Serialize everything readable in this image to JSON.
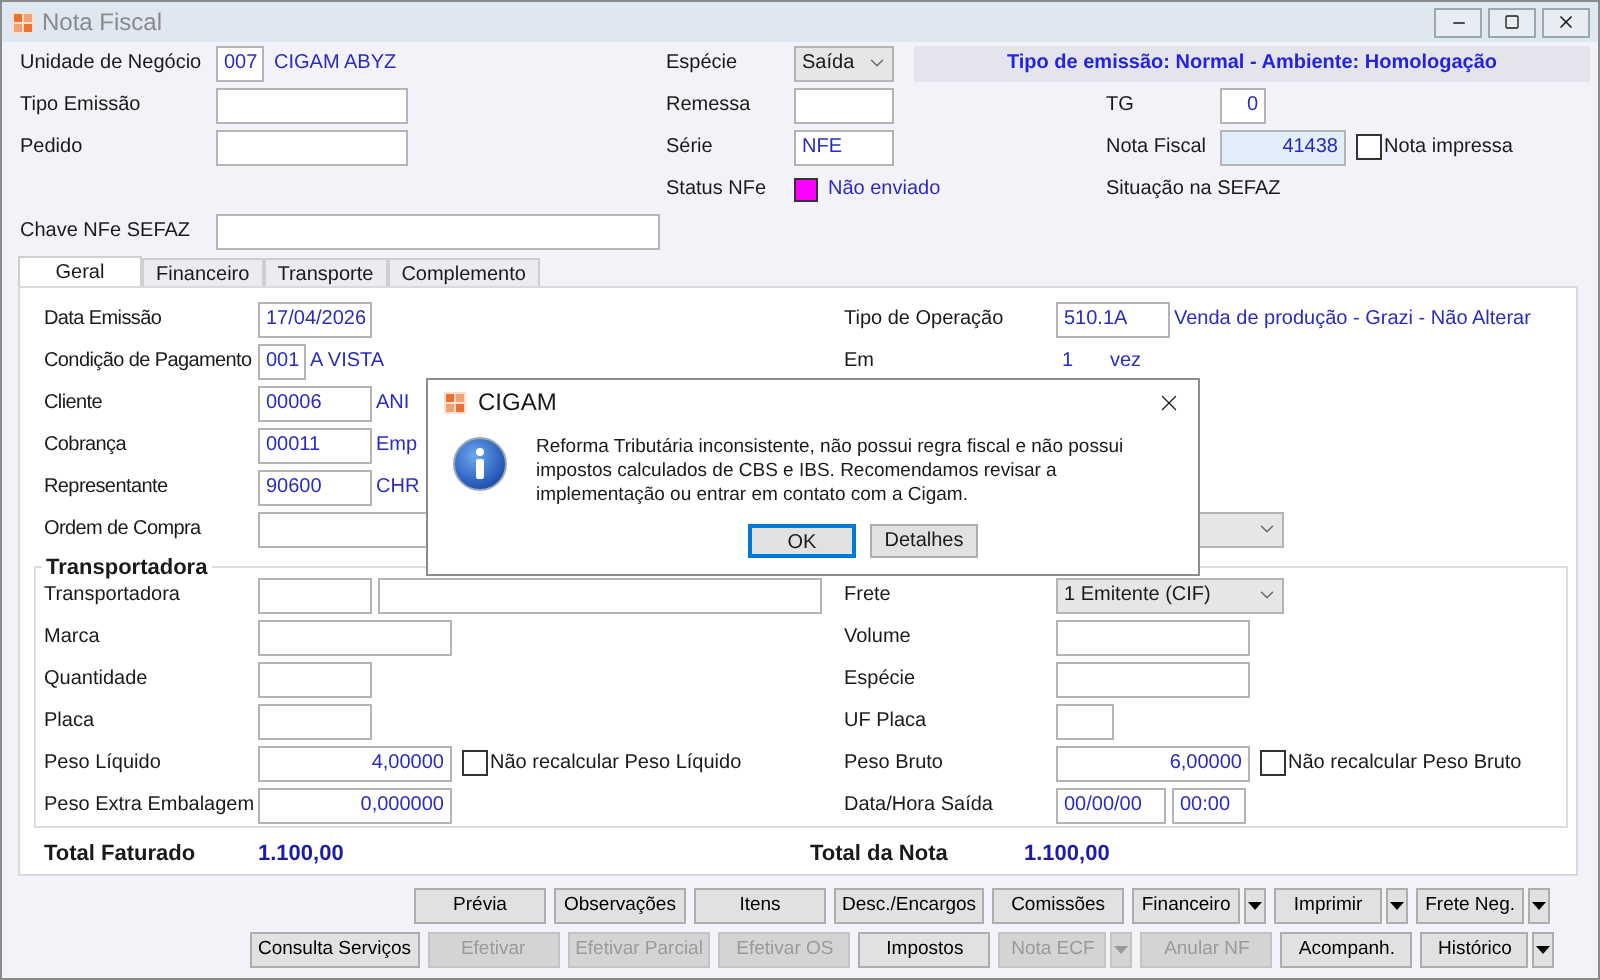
{
  "window": {
    "title": "Nota Fiscal"
  },
  "header": {
    "business_unit": {
      "label": "Unidade de Negócio",
      "code": "007",
      "name": "CIGAM ABYZ"
    },
    "emission_type": {
      "label": "Tipo Emissão"
    },
    "order": {
      "label": "Pedido"
    },
    "nfe_key": {
      "label": "Chave NFe SEFAZ"
    },
    "species": {
      "label": "Espécie",
      "value": "Saída"
    },
    "shipment": {
      "label": "Remessa"
    },
    "series": {
      "label": "Série",
      "value": "NFE"
    },
    "nfe_status": {
      "label": "Status NFe",
      "color": "#ff00ff",
      "text": "Não enviado"
    },
    "banner": "Tipo de emissão: Normal - Ambiente: Homologação",
    "tg": {
      "label": "TG",
      "value": "0"
    },
    "invoice": {
      "label": "Nota Fiscal",
      "value": "41438",
      "printed_label": "Nota impressa",
      "printed": false
    },
    "sefaz_status": {
      "label": "Situação na SEFAZ"
    }
  },
  "tabs": [
    {
      "label": "Geral",
      "selected": true
    },
    {
      "label": "Financeiro",
      "selected": false
    },
    {
      "label": "Transporte",
      "selected": false
    },
    {
      "label": "Complemento",
      "selected": false
    }
  ],
  "general": {
    "rows": [
      {
        "left": {
          "kind": "date",
          "label": "Data Emissão",
          "value": "17/04/2026"
        },
        "right": {
          "kind": "code",
          "label": "Tipo de Operação",
          "value": "510.1A",
          "name": "Venda de produção - Grazi - Não Alterar"
        }
      },
      {
        "left": {
          "kind": "shortcode",
          "label": "Condição de Pagamento",
          "value": "001",
          "name": "A VISTA"
        },
        "right": {
          "kind": "count",
          "label": "Em",
          "value": "1",
          "unit": "vez"
        }
      },
      {
        "left": {
          "kind": "code",
          "label": "Cliente",
          "value": "00006",
          "name": "ANI"
        }
      },
      {
        "left": {
          "kind": "code",
          "label": "Cobrança",
          "value": "00011",
          "name": "Emp"
        }
      },
      {
        "left": {
          "kind": "code",
          "label": "Representante",
          "value": "90600",
          "name": "CHR"
        }
      },
      {
        "left": {
          "kind": "wide",
          "label": "Ordem de Compra"
        },
        "right": {
          "kind": "select"
        }
      }
    ],
    "carrier": {
      "title": "Transportadora",
      "rows": [
        {
          "left": {
            "kind": "pair",
            "label": "Transportadora"
          },
          "right": {
            "kind": "select",
            "label": "Frete",
            "value": "1 Emitente (CIF)"
          }
        },
        {
          "left": {
            "kind": "text",
            "label": "Marca"
          },
          "right": {
            "kind": "text",
            "label": "Volume"
          }
        },
        {
          "left": {
            "kind": "short",
            "label": "Quantidade"
          },
          "right": {
            "kind": "text",
            "label": "Espécie"
          }
        },
        {
          "left": {
            "kind": "short",
            "label": "Placa"
          },
          "right": {
            "kind": "tiny",
            "label": "UF Placa"
          }
        },
        {
          "left": {
            "kind": "number",
            "label": "Peso Líquido",
            "value": "4,00000",
            "check_label": "Não recalcular Peso Líquido",
            "checked": false
          },
          "right": {
            "kind": "number",
            "label": "Peso Bruto",
            "value": "6,00000",
            "check_label": "Não recalcular Peso Bruto",
            "checked": false
          }
        },
        {
          "left": {
            "kind": "number",
            "label": "Peso Extra Embalagem",
            "value": "0,000000"
          },
          "right": {
            "kind": "datetime",
            "label": "Data/Hora Saída",
            "value": "00/00/00",
            "time": "00:00"
          }
        }
      ]
    },
    "totals": [
      {
        "label": "Total Faturado",
        "value": "1.100,00"
      },
      {
        "label": "Total da Nota",
        "value": "1.100,00"
      }
    ]
  },
  "buttons": [
    [
      {
        "label": "Prévia",
        "disabled": false,
        "dropdown": false
      },
      {
        "label": "Observações",
        "disabled": false,
        "dropdown": false
      },
      {
        "label": "Itens",
        "disabled": false,
        "dropdown": false
      },
      {
        "label": "Desc./Encargos",
        "disabled": false,
        "dropdown": false
      },
      {
        "label": "Comissões",
        "disabled": false,
        "dropdown": false
      },
      {
        "label": "Financeiro",
        "disabled": false,
        "dropdown": true
      },
      {
        "label": "Imprimir",
        "disabled": false,
        "dropdown": true
      },
      {
        "label": "Frete Neg.",
        "disabled": false,
        "dropdown": true
      }
    ],
    [
      {
        "label": "Consulta Serviços",
        "disabled": false,
        "dropdown": false
      },
      {
        "label": "Efetivar",
        "disabled": true,
        "dropdown": false
      },
      {
        "label": "Efetivar Parcial",
        "disabled": true,
        "dropdown": false
      },
      {
        "label": "Efetivar OS",
        "disabled": true,
        "dropdown": false
      },
      {
        "label": "Impostos",
        "disabled": false,
        "dropdown": false
      },
      {
        "label": "Nota ECF",
        "disabled": true,
        "dropdown": true
      },
      {
        "label": "Anular NF",
        "disabled": true,
        "dropdown": false
      },
      {
        "label": "Acompanh.",
        "disabled": false,
        "dropdown": false
      },
      {
        "label": "Histórico",
        "disabled": false,
        "dropdown": true
      }
    ]
  ],
  "dialog": {
    "title": "CIGAM",
    "message": "Reforma Tributária inconsistente, não possui regra fiscal e não possui impostos calculados de CBS e IBS. Recomendamos revisar a implementação ou entrar em contato com a Cigam.",
    "buttons": [
      {
        "label": "OK",
        "selected": true
      },
      {
        "label": "Detalhes",
        "selected": false
      }
    ]
  }
}
